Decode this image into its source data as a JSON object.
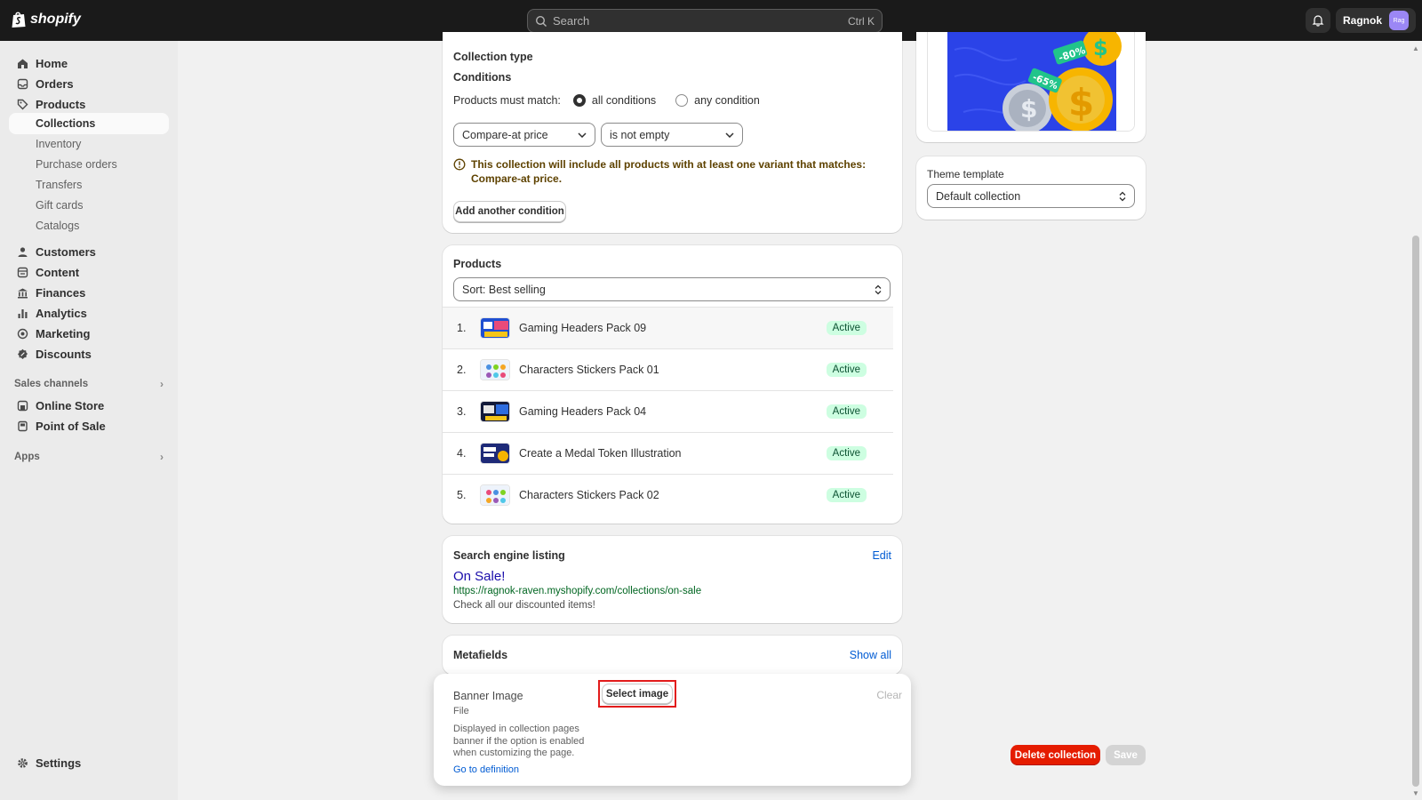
{
  "topbar": {
    "brand": "shopify",
    "search_placeholder": "Search",
    "search_shortcut": "Ctrl K",
    "user_name": "Ragnok",
    "avatar_initials": "Rag"
  },
  "sidebar": {
    "items": [
      {
        "label": "Home",
        "icon": "home-icon"
      },
      {
        "label": "Orders",
        "icon": "inbox-icon"
      },
      {
        "label": "Products",
        "icon": "tag-icon"
      }
    ],
    "product_sub": [
      "Collections",
      "Inventory",
      "Purchase orders",
      "Transfers",
      "Gift cards",
      "Catalogs"
    ],
    "items2": [
      {
        "label": "Customers",
        "icon": "person-icon"
      },
      {
        "label": "Content",
        "icon": "content-icon"
      },
      {
        "label": "Finances",
        "icon": "bank-icon"
      },
      {
        "label": "Analytics",
        "icon": "chart-icon"
      },
      {
        "label": "Marketing",
        "icon": "target-icon"
      },
      {
        "label": "Discounts",
        "icon": "discount-icon"
      }
    ],
    "sales_channels": "Sales channels",
    "channels": [
      {
        "label": "Online Store",
        "icon": "store-icon"
      },
      {
        "label": "Point of Sale",
        "icon": "pos-icon"
      }
    ],
    "apps": "Apps",
    "settings": "Settings"
  },
  "collection_type": {
    "title": "Collection type",
    "conditions": "Conditions",
    "must_match": "Products must match:",
    "all_conditions": "all conditions",
    "any_condition": "any condition",
    "field_select": "Compare-at price",
    "operator_select": "is not empty",
    "info": "This collection will include all products with at least one variant that matches: Compare-at price.",
    "add_condition": "Add another condition"
  },
  "products": {
    "title": "Products",
    "sort": "Sort: Best selling",
    "rows": [
      {
        "num": "1.",
        "name": "Gaming Headers Pack 09",
        "status": "Active"
      },
      {
        "num": "2.",
        "name": "Characters Stickers Pack 01",
        "status": "Active"
      },
      {
        "num": "3.",
        "name": "Gaming Headers Pack 04",
        "status": "Active"
      },
      {
        "num": "4.",
        "name": "Create a Medal Token Illustration",
        "status": "Active"
      },
      {
        "num": "5.",
        "name": "Characters Stickers Pack 02",
        "status": "Active"
      }
    ]
  },
  "seo": {
    "title": "Search engine listing",
    "edit": "Edit",
    "page_title": "On Sale!",
    "url": "https://ragnok-raven.myshopify.com/collections/on-sale",
    "description": "Check all our discounted items!"
  },
  "metafields": {
    "title": "Metafields",
    "show_all": "Show all",
    "field_name": "Banner Image",
    "field_type": "File",
    "field_desc": "Displayed in collection pages banner if the option is enabled when customizing the page.",
    "definition_link": "Go to definition",
    "select_image": "Select image",
    "clear": "Clear"
  },
  "image_card": {
    "badge1": "-80%",
    "badge2": "-65%"
  },
  "theme": {
    "title": "Theme template",
    "value": "Default collection"
  },
  "actions": {
    "delete": "Delete collection",
    "save": "Save"
  },
  "colors": {
    "accent": "#005bd3",
    "danger": "#e51c00",
    "topbar": "#1a1a1a",
    "success_bg": "#cdfee1"
  }
}
